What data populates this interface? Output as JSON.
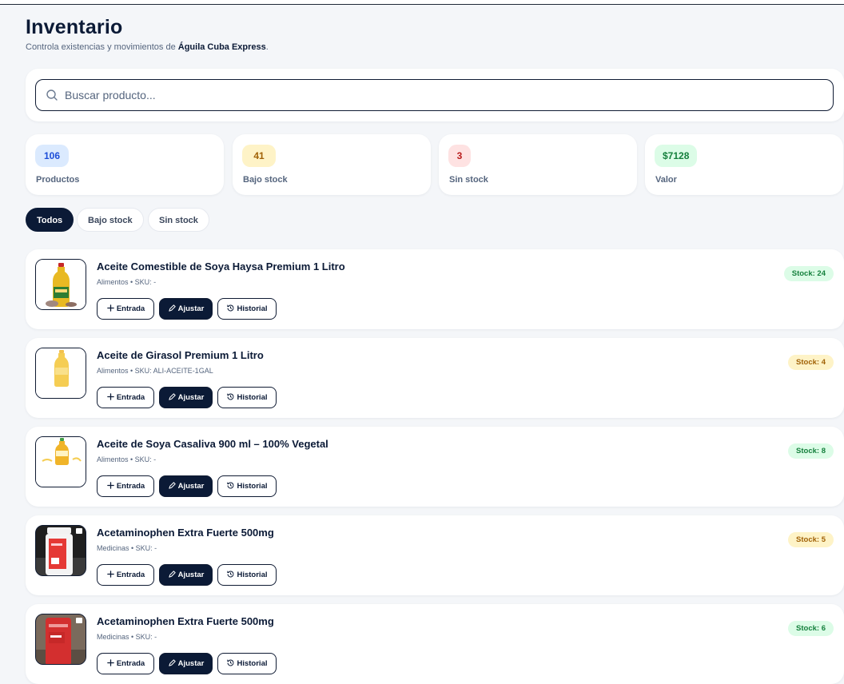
{
  "header": {
    "title": "Inventario",
    "subtitle_prefix": "Controla existencias y movimientos de ",
    "business_name": "Águila Cuba Express",
    "subtitle_suffix": "."
  },
  "search": {
    "placeholder": "Buscar producto...",
    "value": ""
  },
  "stats": [
    {
      "value": "106",
      "label": "Productos"
    },
    {
      "value": "41",
      "label": "Bajo stock"
    },
    {
      "value": "3",
      "label": "Sin stock"
    },
    {
      "value": "$7128",
      "label": "Valor"
    }
  ],
  "colors": {
    "stat_blue_bg": "#dbeafe",
    "stat_blue_fg": "#1d4ed8",
    "stat_yellow_bg": "#fef3c7",
    "stat_yellow_fg": "#a16207",
    "stat_red_bg": "#fee2e2",
    "stat_red_fg": "#b91c1c",
    "stat_green_bg": "#dcfce7",
    "stat_green_fg": "#15803d",
    "primary": "#0b1a36"
  },
  "filters": {
    "all": "Todos",
    "low": "Bajo stock",
    "none": "Sin stock"
  },
  "actions": {
    "entry": "Entrada",
    "adjust": "Ajustar",
    "history": "Historial"
  },
  "products": [
    {
      "name": "Aceite Comestible de Soya Haysa Premium 1 Litro",
      "meta": "Alimentos • SKU: -",
      "stock": "Stock: 24"
    },
    {
      "name": "Aceite de Girasol Premium 1 Litro",
      "meta": "Alimentos • SKU: ALI-ACEITE-1GAL",
      "stock": "Stock: 4"
    },
    {
      "name": "Aceite de Soya Casaliva 900 ml – 100% Vegetal",
      "meta": "Alimentos • SKU: -",
      "stock": "Stock: 8"
    },
    {
      "name": "Acetaminophen Extra Fuerte 500mg",
      "meta": "Medicinas • SKU: -",
      "stock": "Stock: 5"
    },
    {
      "name": "Acetaminophen Extra Fuerte 500mg",
      "meta": "Medicinas • SKU: -",
      "stock": "Stock: 6"
    }
  ]
}
